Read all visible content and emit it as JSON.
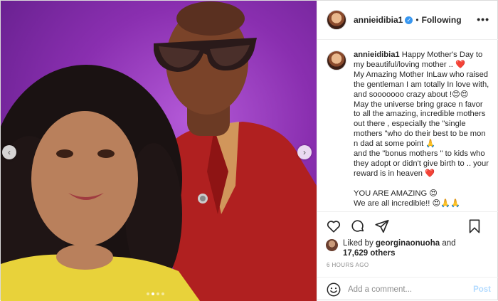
{
  "post": {
    "username": "annieidibia1",
    "follow_status": "Following",
    "header_separator": "•",
    "more_glyph": "•••",
    "verified_glyph": "✓"
  },
  "caption": {
    "username": "annieidibia1",
    "text": " Happy Mother's Day to my beautiful/loving mother .. ❤️\nMy Amazing Mother InLaw who raised the gentleman I am totally In love with, and sooooooo crazy about !😍😍\nMay the universe bring grace n favor to all the amazing, incredible mothers out there , especially the \"single mothers \"who do their best to be mon n dad at some point 🙏\nand the \"bonus mothers \" to kids who they adopt or didn't give birth to .. your reward is in heaven ❤️\n\nYOU ARE AMAZING 😍\nWe are all incredible!! 😍🙏🙏"
  },
  "carousel": {
    "prev_glyph": "‹",
    "next_glyph": "›",
    "dot_count": 4,
    "active_dot": 1
  },
  "likes": {
    "prefix": "Liked by ",
    "user": "georginaonuoha",
    "middle": " and",
    "count": "17,629 others"
  },
  "timestamp": "6 HOURS AGO",
  "comment": {
    "placeholder": "Add a comment...",
    "post_label": "Post"
  },
  "colors": {
    "verified": "#3897f0",
    "post_disabled": "#b3dbff",
    "photo_bg": "#8a2fb0"
  }
}
